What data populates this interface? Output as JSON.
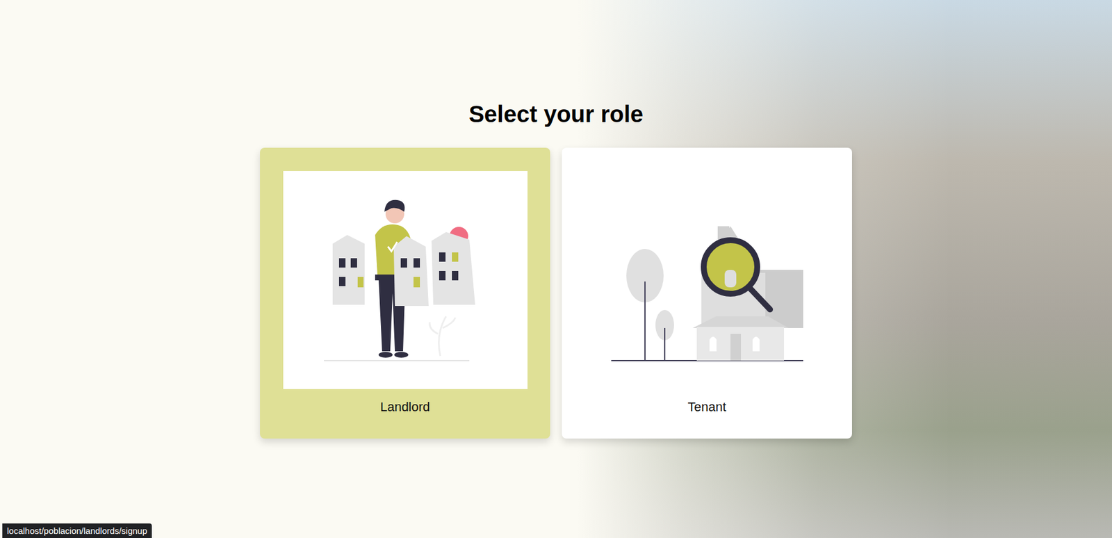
{
  "heading": "Select your role",
  "roles": [
    {
      "label": "Landlord",
      "kind": "landlord",
      "selected": true
    },
    {
      "label": "Tenant",
      "kind": "tenant",
      "selected": false
    }
  ],
  "status_bar": {
    "url": "localhost/poblacion/landlords/signup"
  }
}
